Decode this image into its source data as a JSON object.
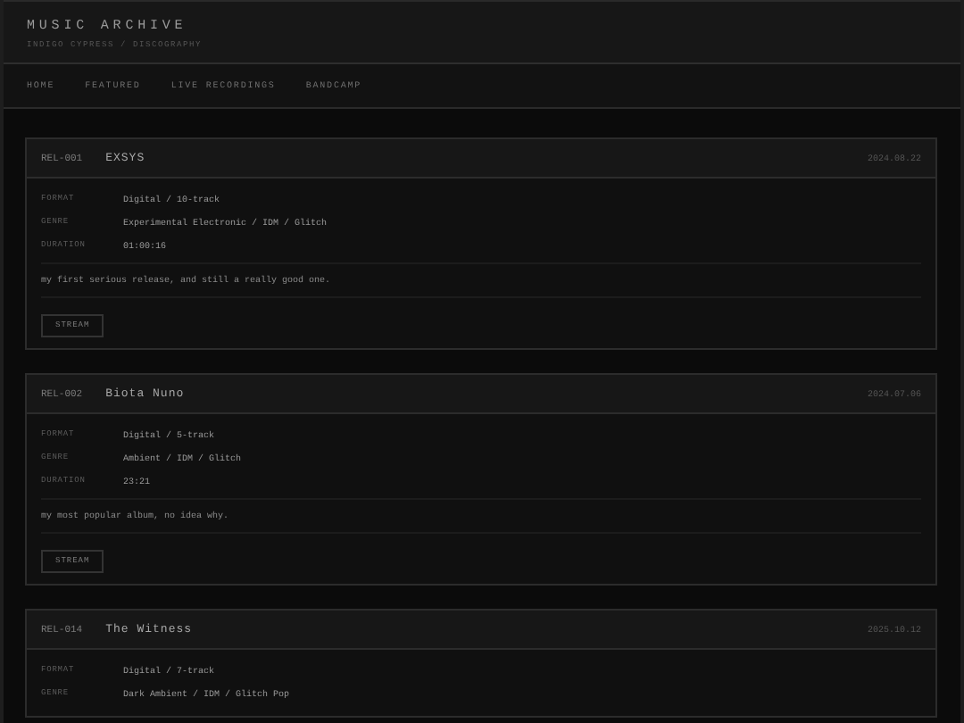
{
  "header": {
    "title": "MUSIC ARCHIVE",
    "subtitle": "INDIGO CYPRESS / DISCOGRAPHY"
  },
  "nav": [
    {
      "label": "HOME"
    },
    {
      "label": "FEATURED"
    },
    {
      "label": "LIVE RECORDINGS"
    },
    {
      "label": "BANDCAMP"
    }
  ],
  "releases": [
    {
      "id": "REL-001",
      "title": "EXSYS",
      "date": "2024.08.22",
      "fields": [
        {
          "label": "FORMAT",
          "value": "Digital / 10-track"
        },
        {
          "label": "GENRE",
          "value": "Experimental Electronic / IDM / Glitch"
        },
        {
          "label": "DURATION",
          "value": "01:00:16"
        }
      ],
      "note": "my first serious release, and still a really good one.",
      "button": "STREAM"
    },
    {
      "id": "REL-002",
      "title": "Biota Nuno",
      "date": "2024.07.06",
      "fields": [
        {
          "label": "FORMAT",
          "value": "Digital / 5-track"
        },
        {
          "label": "GENRE",
          "value": "Ambient / IDM / Glitch"
        },
        {
          "label": "DURATION",
          "value": "23:21"
        }
      ],
      "note": "my most popular album, no idea why.",
      "button": "STREAM"
    },
    {
      "id": "REL-014",
      "title": "The Witness",
      "date": "2025.10.12",
      "fields": [
        {
          "label": "FORMAT",
          "value": "Digital / 7-track"
        },
        {
          "label": "GENRE",
          "value": "Dark Ambient / IDM / Glitch Pop"
        }
      ]
    }
  ]
}
